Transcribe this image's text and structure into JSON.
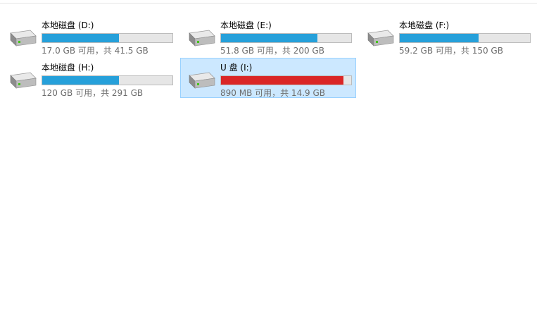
{
  "drives": [
    {
      "id": "d",
      "name": "本地磁盘 (D:)",
      "free_space": "17.0 GB 可用，共 41.5 GB",
      "used_fraction": 0.59,
      "fill_color": "#26a0da",
      "icon": "hard-drive-icon",
      "selected": false
    },
    {
      "id": "e",
      "name": "本地磁盘 (E:)",
      "free_space": "51.8 GB 可用，共 200 GB",
      "used_fraction": 0.74,
      "fill_color": "#26a0da",
      "icon": "hard-drive-icon",
      "selected": false
    },
    {
      "id": "f",
      "name": "本地磁盘 (F:)",
      "free_space": "59.2 GB 可用，共 150 GB",
      "used_fraction": 0.605,
      "fill_color": "#26a0da",
      "icon": "hard-drive-icon",
      "selected": false
    },
    {
      "id": "h",
      "name": "本地磁盘 (H:)",
      "free_space": "120 GB 可用，共 291 GB",
      "used_fraction": 0.588,
      "fill_color": "#26a0da",
      "icon": "hard-drive-icon",
      "selected": false
    },
    {
      "id": "i",
      "name": "U 盘 (I:)",
      "free_space": "890 MB 可用，共 14.9 GB",
      "used_fraction": 0.942,
      "fill_color": "#da2626",
      "icon": "usb-drive-icon",
      "selected": true
    }
  ]
}
